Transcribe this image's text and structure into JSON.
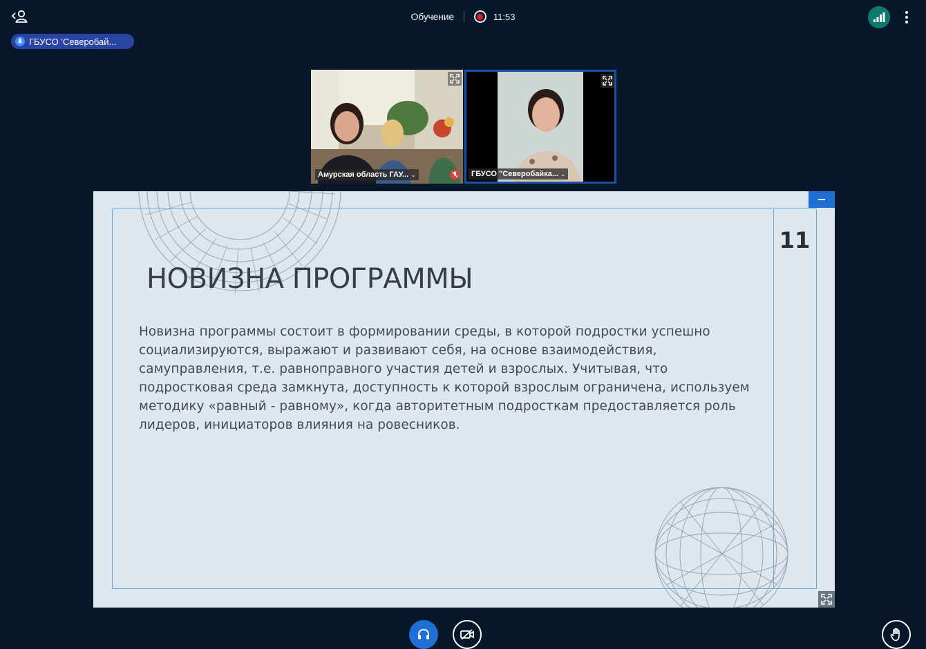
{
  "header": {
    "meeting_title": "Обучение",
    "recording_time": "11:53",
    "icons": {
      "users": "user-list-icon",
      "recording": "record-icon",
      "connection": "signal-bars-icon",
      "options": "more-vertical-icon"
    },
    "colors": {
      "background": "#07182a",
      "connection": "#0e7a6d",
      "recording": "#e01e2b"
    }
  },
  "talker": {
    "name": "ГБУСО 'Северобай..."
  },
  "videos": [
    {
      "label": "Амурская область ГАУ...",
      "muted": true
    },
    {
      "label": "ГБУСО \"Северобайка...",
      "muted": false,
      "active": true
    }
  ],
  "presentation": {
    "slide_number": "11",
    "title": "НОВИЗНА ПРОГРАММЫ",
    "body": "Новизна программы состоит в формировании среды, в которой подростки успешно социализируются, выражают и развивают себя, на основе взаимодействия, самуправления, т.е. равноправного участия детей и взрослых. Учитывая, что подростковая среда замкнута, доступность к которой взрослым ограничена, используем методику «равный - равному», когда авторитетным подросткам предоставляется роль лидеров, инициаторов влияния на ровесников.",
    "colors": {
      "slide_bg": "#dfe7ee",
      "frame": "#6aa8e0",
      "minimize": "#1e6fd1"
    }
  },
  "controls": {
    "icons": {
      "audio": "headphones-icon",
      "camera": "camera-off-icon",
      "raise_hand": "hand-icon"
    },
    "colors": {
      "audio_active": "#1f6fd6"
    }
  }
}
